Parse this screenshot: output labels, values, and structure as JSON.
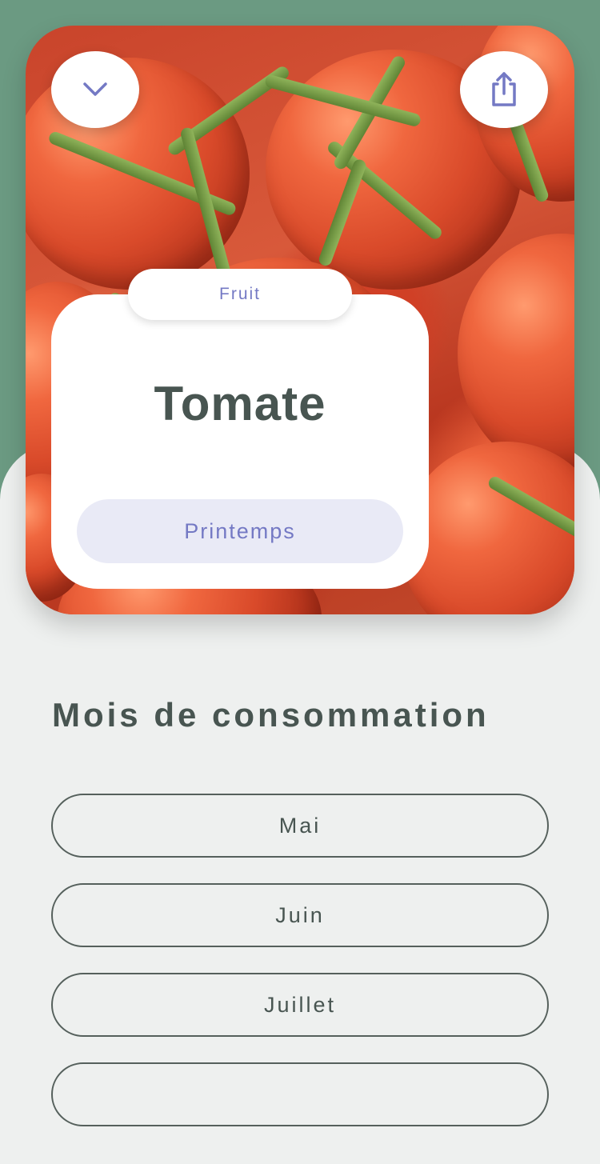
{
  "header": {
    "collapse_icon": "chevron-down-icon",
    "share_icon": "share-icon"
  },
  "product": {
    "category": "Fruit",
    "name": "Tomate",
    "season": "Printemps"
  },
  "consumption": {
    "title": "Mois de consommation",
    "months": [
      "Mai",
      "Juin",
      "Juillet"
    ]
  },
  "colors": {
    "background_green": "#6b9a82",
    "sheet": "#eef0ef",
    "accent": "#7479c4",
    "text": "#485551"
  }
}
